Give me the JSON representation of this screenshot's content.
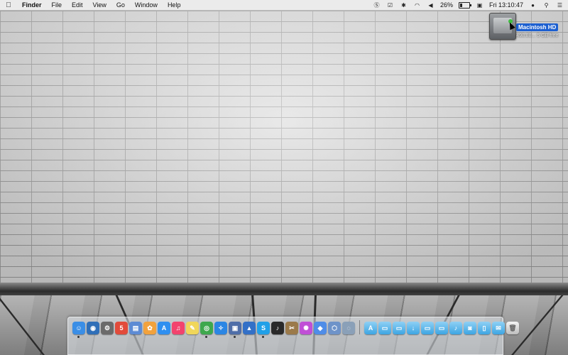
{
  "menubar": {
    "apple_icon": "apple-logo-icon",
    "app_name": "Finder",
    "menus": [
      "File",
      "Edit",
      "View",
      "Go",
      "Window",
      "Help"
    ],
    "battery_percent": "26%",
    "battery_level": 0.26,
    "clock": "Fri 13:10:47"
  },
  "desktop": {
    "hd_name": "Macintosh HD",
    "hd_free": "498.88... 5 GB free"
  },
  "dock": {
    "apps": [
      {
        "icon": "finder-icon",
        "glyph": "☺",
        "color": "#3a8ee6",
        "running": true
      },
      {
        "icon": "dashboard-icon",
        "glyph": "◉",
        "color": "#2f6fb8",
        "running": false
      },
      {
        "icon": "system-preferences-icon",
        "glyph": "⚙",
        "color": "#6b6b6b",
        "running": false
      },
      {
        "icon": "calendar-icon",
        "glyph": "5",
        "color": "#e24b3b",
        "running": false
      },
      {
        "icon": "preview-icon",
        "glyph": "▤",
        "color": "#5d8bd4",
        "running": false
      },
      {
        "icon": "photos-icon",
        "glyph": "✿",
        "color": "#f2a23c",
        "running": false
      },
      {
        "icon": "app-store-icon",
        "glyph": "A",
        "color": "#2f8ff0",
        "running": false
      },
      {
        "icon": "itunes-icon",
        "glyph": "♫",
        "color": "#f2436e",
        "running": false
      },
      {
        "icon": "notes-icon",
        "glyph": "✎",
        "color": "#f0d65a",
        "running": false
      },
      {
        "icon": "chrome-icon",
        "glyph": "◎",
        "color": "#3ea84d",
        "running": true
      },
      {
        "icon": "safari-icon",
        "glyph": "✧",
        "color": "#2b86e4",
        "running": false
      },
      {
        "icon": "file-utility-icon",
        "glyph": "▣",
        "color": "#4f6ea8",
        "running": true
      },
      {
        "icon": "xcode-icon",
        "glyph": "▲",
        "color": "#3370c7",
        "running": false
      },
      {
        "icon": "skype-icon",
        "glyph": "S",
        "color": "#21a0e8",
        "running": true
      },
      {
        "icon": "music-player-icon",
        "glyph": "♪",
        "color": "#2a2a2a",
        "running": false
      },
      {
        "icon": "archive-utility-icon",
        "glyph": "✂",
        "color": "#9b7a4a",
        "running": false
      },
      {
        "icon": "flower-app-icon",
        "glyph": "✺",
        "color": "#c04fd6",
        "running": false
      },
      {
        "icon": "dropbox-icon",
        "glyph": "◆",
        "color": "#4f8de8",
        "running": false
      },
      {
        "icon": "package-icon",
        "glyph": "⬡",
        "color": "#6e93c9",
        "running": false
      },
      {
        "icon": "compass-app-icon",
        "glyph": "◌",
        "color": "#8aa0b8",
        "running": false
      }
    ],
    "folders": [
      {
        "icon": "applications-folder-icon",
        "glyph": "A"
      },
      {
        "icon": "documents-folder-icon",
        "glyph": "▭"
      },
      {
        "icon": "desktop-folder-icon",
        "glyph": "▭"
      },
      {
        "icon": "downloads-folder-icon",
        "glyph": "↓"
      },
      {
        "icon": "movies-folder-icon",
        "glyph": "▭"
      },
      {
        "icon": "pictures-folder-icon",
        "glyph": "▭"
      },
      {
        "icon": "music-folder-icon",
        "glyph": "♪"
      },
      {
        "icon": "screenshot-folder-icon",
        "glyph": "◙"
      },
      {
        "icon": "document-stack-icon",
        "glyph": "▯"
      },
      {
        "icon": "mail-stack-icon",
        "glyph": "✉"
      }
    ],
    "trash_icon": "trash-icon"
  }
}
